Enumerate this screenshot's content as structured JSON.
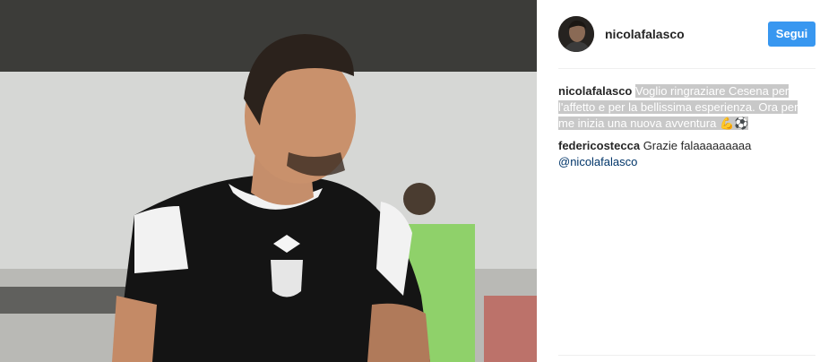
{
  "post": {
    "photo_alt": "",
    "header": {
      "username": "nicolafalasco",
      "follow_label": "Segui"
    },
    "comments": [
      {
        "author": "nicolafalasco",
        "text": "Voglio ringraziare Cesena per l'affetto e per la bellissima esperienza. Ora per me inizia una nuova avventura",
        "emoji": "💪⚽"
      },
      {
        "author": "federicostecca",
        "text": "Grazie falaaaaaaaaa",
        "mention": "@nicolafalasco"
      }
    ]
  },
  "colors": {
    "follow_button": "#3897f0",
    "mention": "#003569",
    "selection_highlight": "#c8c8c8"
  }
}
